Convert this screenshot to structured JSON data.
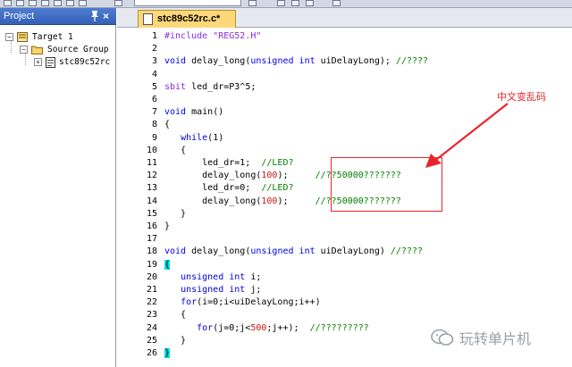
{
  "project_panel": {
    "title": "Project",
    "pin_glyph": "📌",
    "close_glyph": "×",
    "tree": [
      {
        "label": "Target 1",
        "expander": "−"
      },
      {
        "label": "Source Group",
        "expander": "−"
      },
      {
        "label": "stc89c52rc",
        "expander": "+"
      }
    ]
  },
  "editor": {
    "tab_label": "stc89c52rc.c*",
    "lines": [
      {
        "n": "1",
        "tokens": [
          {
            "t": "#include \"REG52.H\"",
            "c": "pre"
          }
        ]
      },
      {
        "n": "2",
        "tokens": []
      },
      {
        "n": "3",
        "tokens": [
          {
            "t": "void",
            "c": "kw"
          },
          {
            "t": " delay_long(",
            "c": "id"
          },
          {
            "t": "unsigned",
            "c": "kw"
          },
          {
            "t": " ",
            "c": "id"
          },
          {
            "t": "int",
            "c": "kw"
          },
          {
            "t": " uiDelayLong); ",
            "c": "id"
          },
          {
            "t": "//????",
            "c": "cm"
          }
        ]
      },
      {
        "n": "4",
        "tokens": []
      },
      {
        "n": "5",
        "tokens": [
          {
            "t": "sbit",
            "c": "pre"
          },
          {
            "t": " led_dr=P3^5;",
            "c": "id"
          }
        ]
      },
      {
        "n": "6",
        "tokens": []
      },
      {
        "n": "7",
        "tokens": [
          {
            "t": "void",
            "c": "kw"
          },
          {
            "t": " main()",
            "c": "id"
          }
        ]
      },
      {
        "n": "8",
        "tokens": [
          {
            "t": "{",
            "c": "id"
          }
        ]
      },
      {
        "n": "9",
        "tokens": [
          {
            "t": "   ",
            "c": "id"
          },
          {
            "t": "while",
            "c": "kw"
          },
          {
            "t": "(1)",
            "c": "id"
          }
        ]
      },
      {
        "n": "10",
        "tokens": [
          {
            "t": "   {",
            "c": "id"
          }
        ]
      },
      {
        "n": "11",
        "tokens": [
          {
            "t": "       led_dr=1;  ",
            "c": "id"
          },
          {
            "t": "//LED?",
            "c": "cm"
          }
        ]
      },
      {
        "n": "12",
        "tokens": [
          {
            "t": "       delay_long(",
            "c": "id"
          },
          {
            "t": "100",
            "c": "num"
          },
          {
            "t": ");     ",
            "c": "id"
          },
          {
            "t": "//??50000???????",
            "c": "cm"
          }
        ]
      },
      {
        "n": "13",
        "tokens": [
          {
            "t": "       led_dr=0;  ",
            "c": "id"
          },
          {
            "t": "//LED?",
            "c": "cm"
          }
        ]
      },
      {
        "n": "14",
        "tokens": [
          {
            "t": "       delay_long(",
            "c": "id"
          },
          {
            "t": "100",
            "c": "num"
          },
          {
            "t": ");     ",
            "c": "id"
          },
          {
            "t": "//??50000???????",
            "c": "cm"
          }
        ]
      },
      {
        "n": "15",
        "tokens": [
          {
            "t": "   }",
            "c": "id"
          }
        ]
      },
      {
        "n": "16",
        "tokens": [
          {
            "t": "}",
            "c": "id"
          }
        ]
      },
      {
        "n": "17",
        "tokens": []
      },
      {
        "n": "18",
        "tokens": [
          {
            "t": "void",
            "c": "kw"
          },
          {
            "t": " delay_long(",
            "c": "id"
          },
          {
            "t": "unsigned",
            "c": "kw"
          },
          {
            "t": " ",
            "c": "id"
          },
          {
            "t": "int",
            "c": "kw"
          },
          {
            "t": " uiDelayLong) ",
            "c": "id"
          },
          {
            "t": "//????",
            "c": "cm"
          }
        ]
      },
      {
        "n": "19",
        "tokens": [
          {
            "t": "{",
            "c": "hl"
          }
        ]
      },
      {
        "n": "20",
        "tokens": [
          {
            "t": "   ",
            "c": "id"
          },
          {
            "t": "unsigned",
            "c": "kw"
          },
          {
            "t": " ",
            "c": "id"
          },
          {
            "t": "int",
            "c": "kw"
          },
          {
            "t": " i;",
            "c": "id"
          }
        ]
      },
      {
        "n": "21",
        "tokens": [
          {
            "t": "   ",
            "c": "id"
          },
          {
            "t": "unsigned",
            "c": "kw"
          },
          {
            "t": " ",
            "c": "id"
          },
          {
            "t": "int",
            "c": "kw"
          },
          {
            "t": " j;",
            "c": "id"
          }
        ]
      },
      {
        "n": "22",
        "tokens": [
          {
            "t": "   ",
            "c": "id"
          },
          {
            "t": "for",
            "c": "kw"
          },
          {
            "t": "(i=0;i<uiDelayLong;i++)",
            "c": "id"
          }
        ]
      },
      {
        "n": "23",
        "tokens": [
          {
            "t": "   {",
            "c": "id"
          }
        ]
      },
      {
        "n": "24",
        "tokens": [
          {
            "t": "      ",
            "c": "id"
          },
          {
            "t": "for",
            "c": "kw"
          },
          {
            "t": "(j=0;j<",
            "c": "id"
          },
          {
            "t": "500",
            "c": "num"
          },
          {
            "t": ";j++);  ",
            "c": "id"
          },
          {
            "t": "//?????????",
            "c": "cm"
          }
        ]
      },
      {
        "n": "25",
        "tokens": [
          {
            "t": "   }",
            "c": "id"
          }
        ]
      },
      {
        "n": "26",
        "tokens": [
          {
            "t": "}",
            "c": "hl"
          }
        ]
      }
    ]
  },
  "annotation": {
    "label": "中文变乱码",
    "color": "#e8242a"
  },
  "watermark": {
    "text": "玩转单片机"
  },
  "colors": {
    "keyword": "#0000e6",
    "preprocessor": "#8a2be2",
    "comment": "#008000",
    "number": "#c81414",
    "brace_highlight": "#00e0e0",
    "tab_active": "#fdd87a",
    "panel_header": "#3461b8"
  }
}
